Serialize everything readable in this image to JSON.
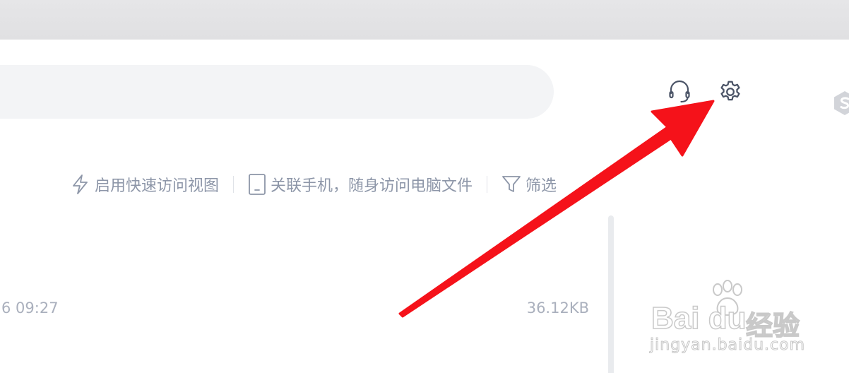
{
  "toolbar": {
    "quick_access": "启用快速访问视图",
    "link_phone": "关联手机，随身访问电脑文件",
    "filter": "筛选"
  },
  "file_row": {
    "time": "6 09:27",
    "size": "36.12KB"
  },
  "header": {
    "support_icon": "headset-icon",
    "settings_icon": "gear-icon"
  },
  "watermark": {
    "brand": "Bai du",
    "brand_cn": "经验",
    "url": "jingyan.baidu.com"
  },
  "colors": {
    "arrow": "#f5121a",
    "icon": "#4a5366",
    "toolbar_text": "#8d96a8"
  }
}
